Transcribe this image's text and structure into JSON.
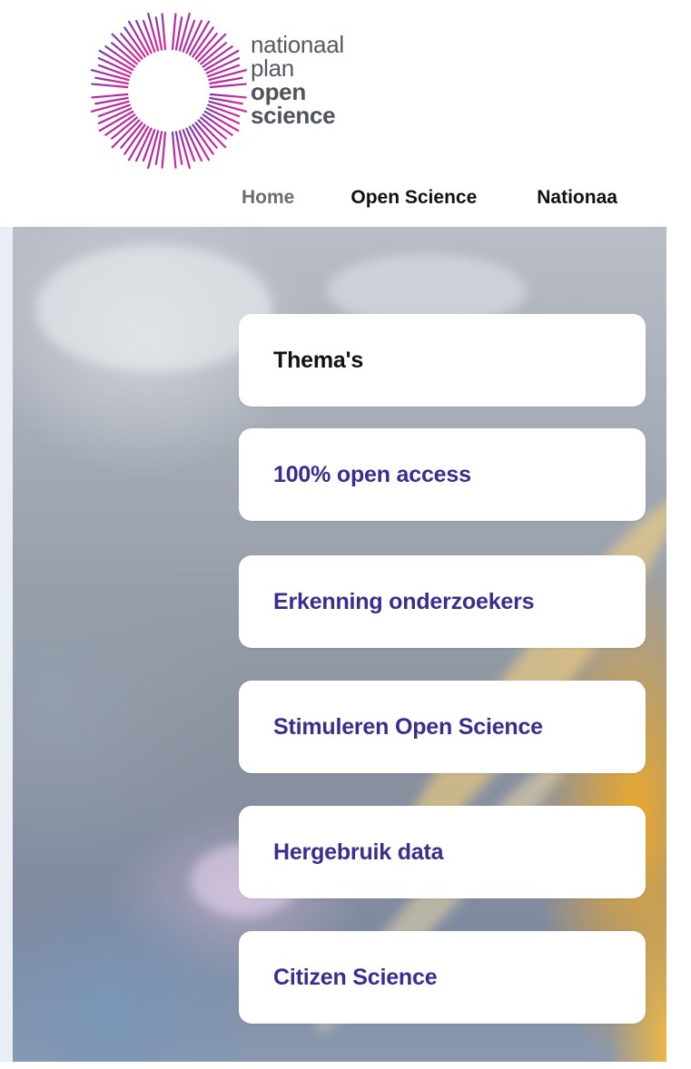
{
  "logo": {
    "line1": "nationaal",
    "line2": "plan",
    "line3": "open",
    "line4": "science",
    "colors": {
      "ring_pink": "#e0249a",
      "ring_purple": "#6b2fa0",
      "text": "#555a60"
    }
  },
  "nav": {
    "items": [
      {
        "label": "Home",
        "active": true
      },
      {
        "label": "Open Science",
        "active": false
      },
      {
        "label": "Nationaa",
        "active": false
      }
    ]
  },
  "themes": {
    "heading": "Thema's",
    "items": [
      {
        "label": "100% open access"
      },
      {
        "label": "Erkenning onderzoekers"
      },
      {
        "label": "Stimuleren Open Science"
      },
      {
        "label": "Hergebruik data"
      },
      {
        "label": "Citizen Science"
      }
    ]
  },
  "colors": {
    "link": "#3b2d8f",
    "heading": "#111111",
    "nav_active": "#6c6c6c"
  }
}
